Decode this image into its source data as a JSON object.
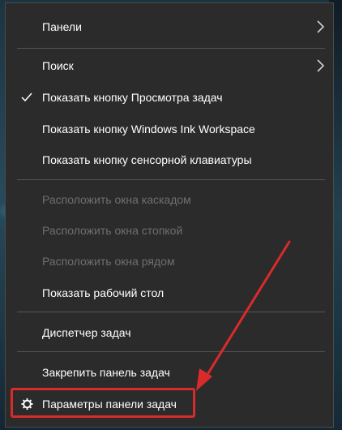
{
  "menu": {
    "items": [
      {
        "label": "Панели",
        "submenu": true
      },
      {
        "label": "Поиск",
        "submenu": true
      },
      {
        "label": "Показать кнопку Просмотра задач",
        "checked": true
      },
      {
        "label": "Показать кнопку Windows Ink Workspace"
      },
      {
        "label": "Показать кнопку сенсорной клавиатуры"
      },
      {
        "label": "Расположить окна каскадом",
        "disabled": true
      },
      {
        "label": "Расположить окна стопкой",
        "disabled": true
      },
      {
        "label": "Расположить окна рядом",
        "disabled": true
      },
      {
        "label": "Показать рабочий стол"
      },
      {
        "label": "Диспетчер задач"
      },
      {
        "label": "Закрепить панель задач"
      },
      {
        "label": "Параметры панели задач",
        "icon": "gear-icon",
        "highlighted": true
      }
    ]
  },
  "icons": {
    "submenu": "chevron-right-icon",
    "checked": "checkmark-icon",
    "settings": "gear-icon"
  },
  "colors": {
    "menu_background": "#2b2b2b",
    "text": "#ffffff",
    "disabled_text": "#6f6f6f",
    "annotation": "#d92b2b"
  }
}
